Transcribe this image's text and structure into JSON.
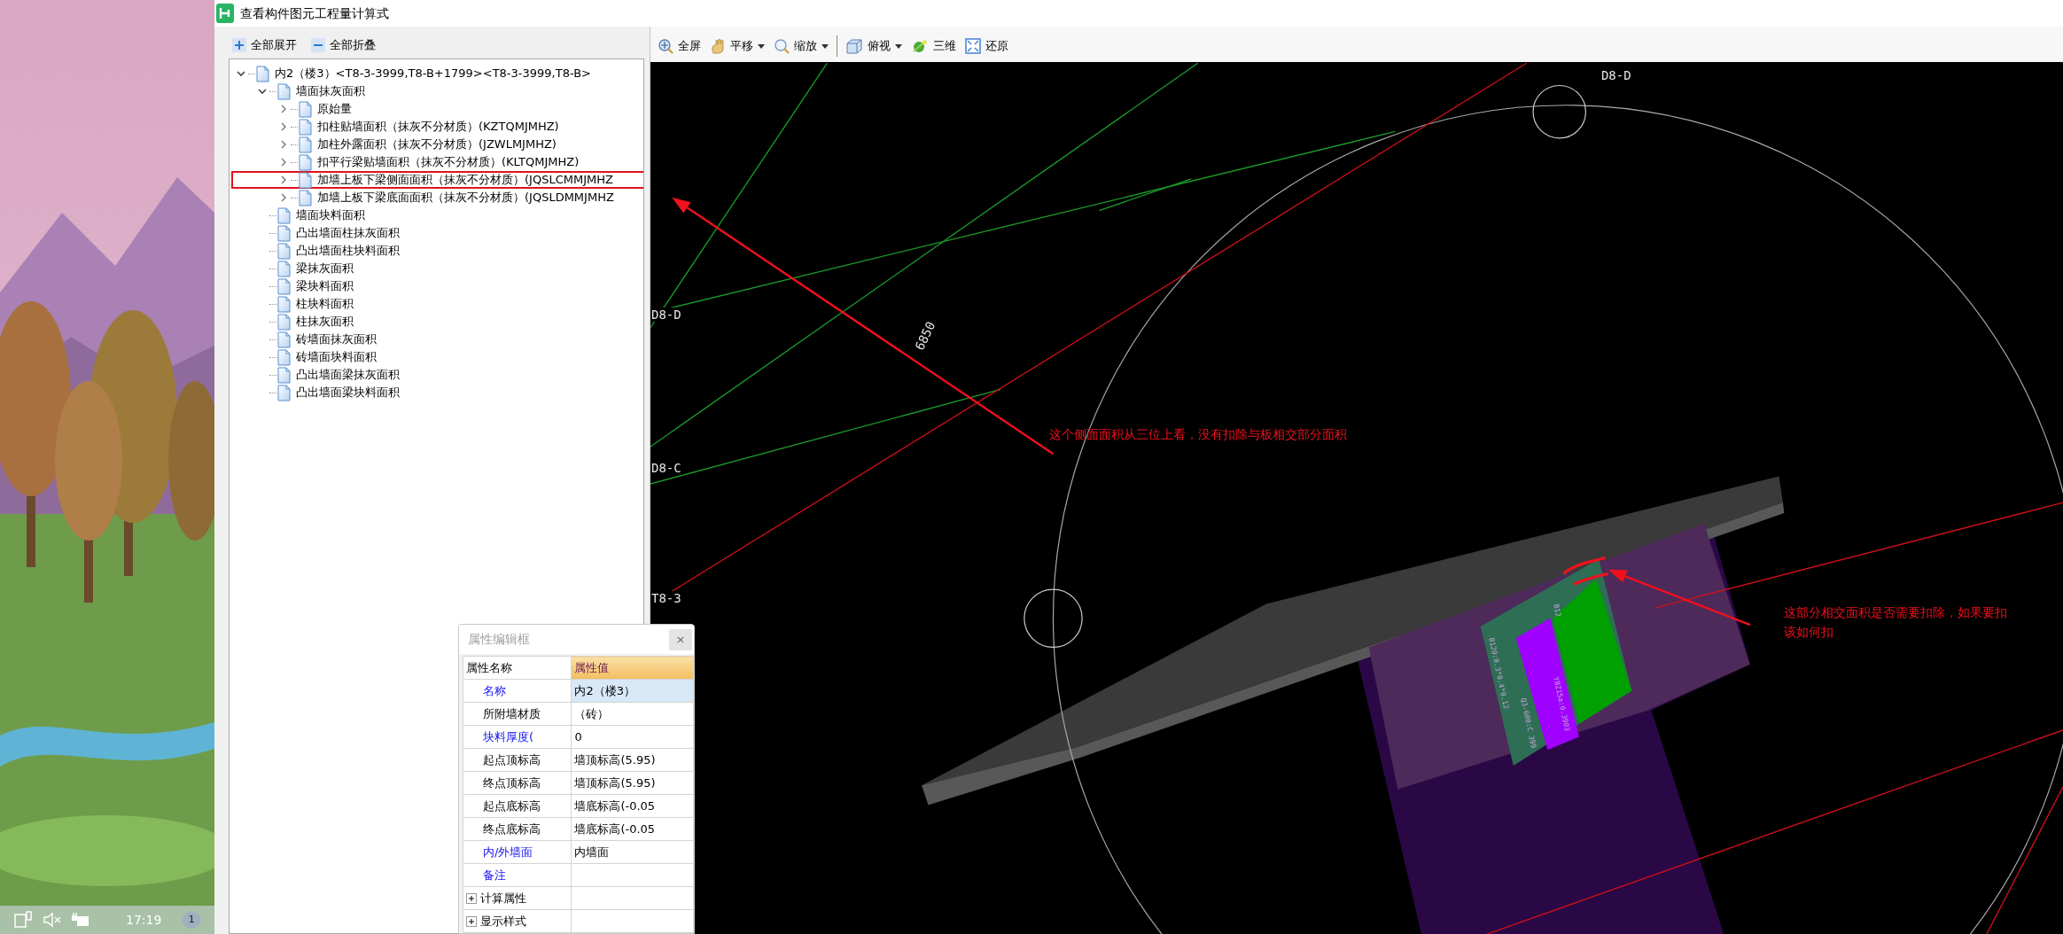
{
  "window": {
    "title": "查看构件图元工程量计算式"
  },
  "desktop": {
    "taskbar": {
      "time": "17:19",
      "badge": "1"
    }
  },
  "tree_toolbar": {
    "buttons": [
      {
        "label": "全部展开",
        "kind": "expand"
      },
      {
        "label": "全部折叠",
        "kind": "collapse"
      }
    ]
  },
  "tree": [
    {
      "label": "内2（楼3）<T8-3-3999,T8-B+1799><T8-3-3999,T8-B>",
      "expanded": true,
      "children": [
        {
          "label": "墙面抹灰面积",
          "expanded": true,
          "children": [
            {
              "label": "原始量",
              "expanded": false,
              "annotated": false
            },
            {
              "label": "扣柱贴墙面积（抹灰不分材质）(KZTQMJMHZ)",
              "expanded": false,
              "annotated": false
            },
            {
              "label": "加柱外露面积（抹灰不分材质）(JZWLMJMHZ)",
              "expanded": false,
              "annotated": false
            },
            {
              "label": "扣平行梁贴墙面积（抹灰不分材质）(KLTQMJMHZ)",
              "expanded": false,
              "annotated": false
            },
            {
              "label": "加墙上板下梁侧面面积（抹灰不分材质）(JQSLCMMJMHZ",
              "expanded": false,
              "annotated": true
            },
            {
              "label": "加墙上板下梁底面面积（抹灰不分材质）(JQSLDMMJMHZ",
              "expanded": false,
              "annotated": false
            }
          ]
        },
        {
          "label": "墙面块料面积"
        },
        {
          "label": "凸出墙面柱抹灰面积"
        },
        {
          "label": "凸出墙面柱块料面积"
        },
        {
          "label": "梁抹灰面积"
        },
        {
          "label": "梁块料面积"
        },
        {
          "label": "柱块料面积"
        },
        {
          "label": "柱抹灰面积"
        },
        {
          "label": "砖墙面抹灰面积"
        },
        {
          "label": "砖墙面块料面积"
        },
        {
          "label": "凸出墙面梁抹灰面积"
        },
        {
          "label": "凸出墙面梁块料面积"
        }
      ]
    }
  ],
  "view_toolbar": {
    "groups": [
      {
        "buttons": [
          {
            "label": "全屏",
            "kind": "zoom-extents",
            "dropdown": false
          },
          {
            "label": "平移",
            "kind": "pan",
            "dropdown": true
          },
          {
            "label": "缩放",
            "kind": "zoom",
            "dropdown": true
          }
        ]
      },
      {
        "buttons": [
          {
            "label": "俯视",
            "kind": "view",
            "dropdown": true
          },
          {
            "label": "三维",
            "kind": "orbit",
            "dropdown": false
          },
          {
            "label": "还原",
            "kind": "restore",
            "dropdown": false
          }
        ]
      }
    ]
  },
  "canvas": {
    "axis_labels": [
      "D8-D",
      "D8-D",
      "D8-C",
      "T8-3"
    ],
    "dimension": "6850",
    "model_labels": [
      "B120:0.3*0.4*0.12",
      "Q3-600:C 399",
      "YBZ15a:0.3903",
      "B12"
    ],
    "annotations": [
      "这个侧面面积从三位上看，没有扣除与板相交部分面积",
      "这部分相交面积是否需要扣除，如果要扣该如何扣"
    ]
  },
  "property_panel": {
    "title": "属性编辑框",
    "close": "×",
    "columns": [
      "属性名称",
      "属性值"
    ],
    "rows": [
      {
        "name": "名称",
        "value": "内2（楼3）",
        "public": true,
        "selected": true
      },
      {
        "name": "所附墙材质",
        "value": "（砖）",
        "public": false,
        "selected": false
      },
      {
        "name": "块料厚度(",
        "value": "0",
        "public": true,
        "selected": false
      },
      {
        "name": "起点顶标高",
        "value": "墙顶标高(5.95)",
        "public": false,
        "selected": false
      },
      {
        "name": "终点顶标高",
        "value": "墙顶标高(5.95)",
        "public": false,
        "selected": false
      },
      {
        "name": "起点底标高",
        "value": "墙底标高(-0.05",
        "public": false,
        "selected": false
      },
      {
        "name": "终点底标高",
        "value": "墙底标高(-0.05",
        "public": false,
        "selected": false
      },
      {
        "name": "内/外墙面",
        "value": "内墙面",
        "public": true,
        "selected": false
      },
      {
        "name": "备注",
        "public": true,
        "selected": false
      }
    ],
    "groups": [
      {
        "label": "计算属性",
        "expanded": false
      },
      {
        "label": "显示样式",
        "expanded": false
      }
    ]
  }
}
